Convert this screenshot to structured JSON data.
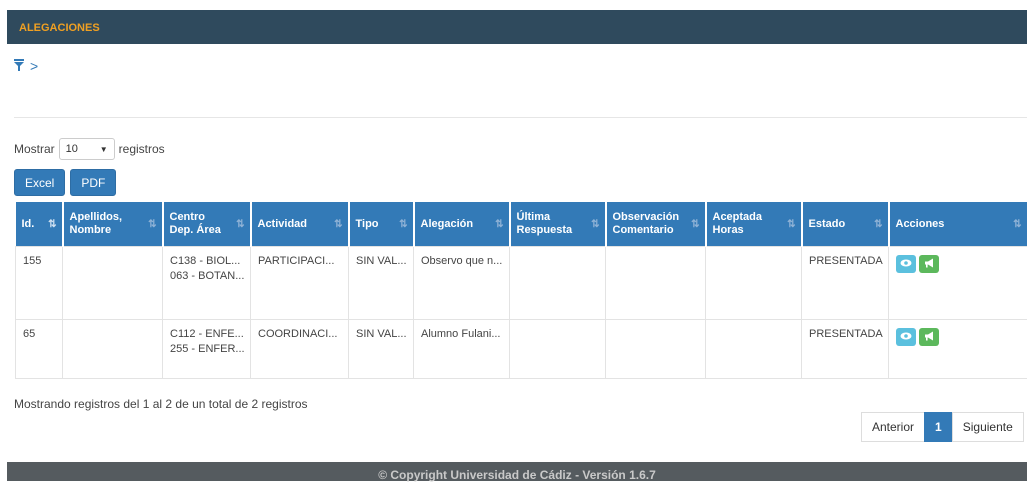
{
  "header": {
    "title": "ALEGACIONES"
  },
  "filter": {
    "chevron": ">"
  },
  "length": {
    "label_before": "Mostrar",
    "value": "10",
    "label_after": "registros"
  },
  "export": {
    "excel": "Excel",
    "pdf": "PDF"
  },
  "table": {
    "columns": [
      {
        "line1": "Id.",
        "line2": ""
      },
      {
        "line1": "Apellidos,",
        "line2": "Nombre"
      },
      {
        "line1": "Centro",
        "line2": "Dep. Área"
      },
      {
        "line1": "Actividad",
        "line2": ""
      },
      {
        "line1": "Tipo",
        "line2": ""
      },
      {
        "line1": "Alegación",
        "line2": ""
      },
      {
        "line1": "Última",
        "line2": "Respuesta"
      },
      {
        "line1": "Observación",
        "line2": "Comentario"
      },
      {
        "line1": "Aceptada",
        "line2": "Horas"
      },
      {
        "line1": "Estado",
        "line2": ""
      },
      {
        "line1": "Acciones",
        "line2": ""
      }
    ],
    "rows": [
      {
        "id": "155",
        "name": "",
        "centro": "C138 - BIOL...",
        "area": "063 - BOTAN...",
        "actividad": "PARTICIPACI...",
        "tipo": "SIN VAL...",
        "alegacion": "Observo que n...",
        "ultima": "",
        "observacion": "",
        "aceptada": "",
        "estado": "PRESENTADA"
      },
      {
        "id": "65",
        "name": "",
        "centro": "C112 - ENFE...",
        "area": "255 - ENFER...",
        "actividad": "COORDINACI...",
        "tipo": "SIN VAL...",
        "alegacion": "Alumno Fulani...",
        "ultima": "",
        "observacion": "",
        "aceptada": "",
        "estado": "PRESENTADA"
      }
    ]
  },
  "summary": "Mostrando registros del 1 al 2 de un total de 2 registros",
  "pagination": {
    "prev": "Anterior",
    "page": "1",
    "next": "Siguiente"
  },
  "footer": {
    "text": "© Copyright Universidad de Cádiz - Versión 1.6.7"
  },
  "colors": {
    "header_bg": "#2f4a5d",
    "title": "#f0a022",
    "primary": "#337ab7",
    "info": "#5bc0de",
    "success": "#5cb85c",
    "footer_bg": "#555b5f"
  },
  "icons": {
    "filter": "filter-icon",
    "view": "eye-icon",
    "announce": "megaphone-icon",
    "sort": "sort-icon"
  }
}
